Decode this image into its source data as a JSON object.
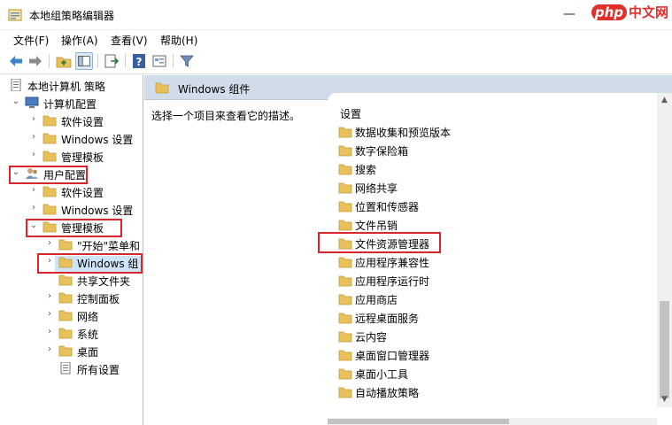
{
  "window": {
    "title": "本地组策略编辑器",
    "minimize_glyph": "—",
    "close_glyph": "✕"
  },
  "watermark": {
    "php": "php",
    "cn": "中文网"
  },
  "menubar": {
    "items": [
      {
        "label": "文件(F)"
      },
      {
        "label": "操作(A)"
      },
      {
        "label": "查看(V)"
      },
      {
        "label": "帮助(H)"
      }
    ]
  },
  "toolbar": {
    "icons": [
      "back-arrow-icon",
      "forward-arrow-icon",
      "up-folder-icon",
      "show-hide-tree-icon",
      "export-list-icon",
      "help-icon",
      "properties-icon",
      "filter-icon"
    ]
  },
  "tree": {
    "root": "本地计算机 策略",
    "computer_config": "计算机配置",
    "cc_software": "软件设置",
    "cc_windows": "Windows 设置",
    "cc_admin": "管理模板",
    "user_config": "用户配置",
    "uc_software": "软件设置",
    "uc_windows": "Windows 设置",
    "uc_admin": "管理模板",
    "start_menu": "\"开始\"菜单和",
    "windows_components": "Windows 组",
    "shared_folders": "共享文件夹",
    "control_panel": "控制面板",
    "network": "网络",
    "system": "系统",
    "desktop": "桌面",
    "all_settings": "所有设置"
  },
  "right": {
    "header_title": "Windows 组件",
    "description": "选择一个项目来查看它的描述。",
    "list_header": "设置",
    "items": [
      "数据收集和预览版本",
      "数字保险箱",
      "搜索",
      "网络共享",
      "位置和传感器",
      "文件吊销",
      "文件资源管理器",
      "应用程序兼容性",
      "应用程序运行时",
      "应用商店",
      "远程桌面服务",
      "云内容",
      "桌面窗口管理器",
      "桌面小工具",
      "自动播放策略"
    ]
  },
  "colors": {
    "highlight_red": "#d9262c",
    "selection": "#cde4f7",
    "header_band": "#d1dcea",
    "folder": "#e8c15a"
  }
}
